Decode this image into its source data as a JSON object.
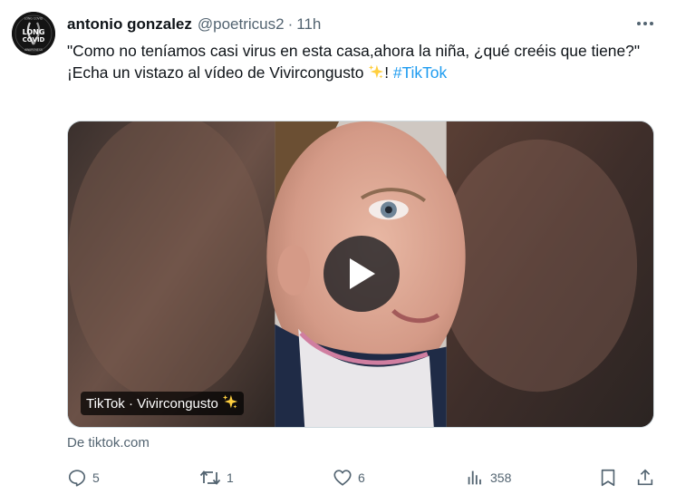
{
  "tweet": {
    "author_name": "antonio gonzalez",
    "handle": "@poetricus2",
    "separator": "·",
    "time": "11h",
    "text_line1": "\"Como no teníamos casi virus en esta casa,ahora la niña, ¿qué creéis que tiene?\"",
    "text_line2_prefix": "¡Echa un vistazo al vídeo de Vivircongusto ",
    "text_line2_suffix": "! ",
    "hashtag": "#TikTok"
  },
  "avatar": {
    "top_text": "LONG COVID",
    "line1": "LONG",
    "line2": "COVID",
    "bottom_text": "AWARENESS"
  },
  "media": {
    "label": "TikTok · Vivircongusto",
    "source": "De tiktok.com"
  },
  "actions": {
    "replies": "5",
    "reposts": "1",
    "likes": "6",
    "views": "358"
  },
  "colors": {
    "accent": "#1d9bf0",
    "secondary_text": "#536471",
    "sparkle": "#ffcf3f"
  }
}
